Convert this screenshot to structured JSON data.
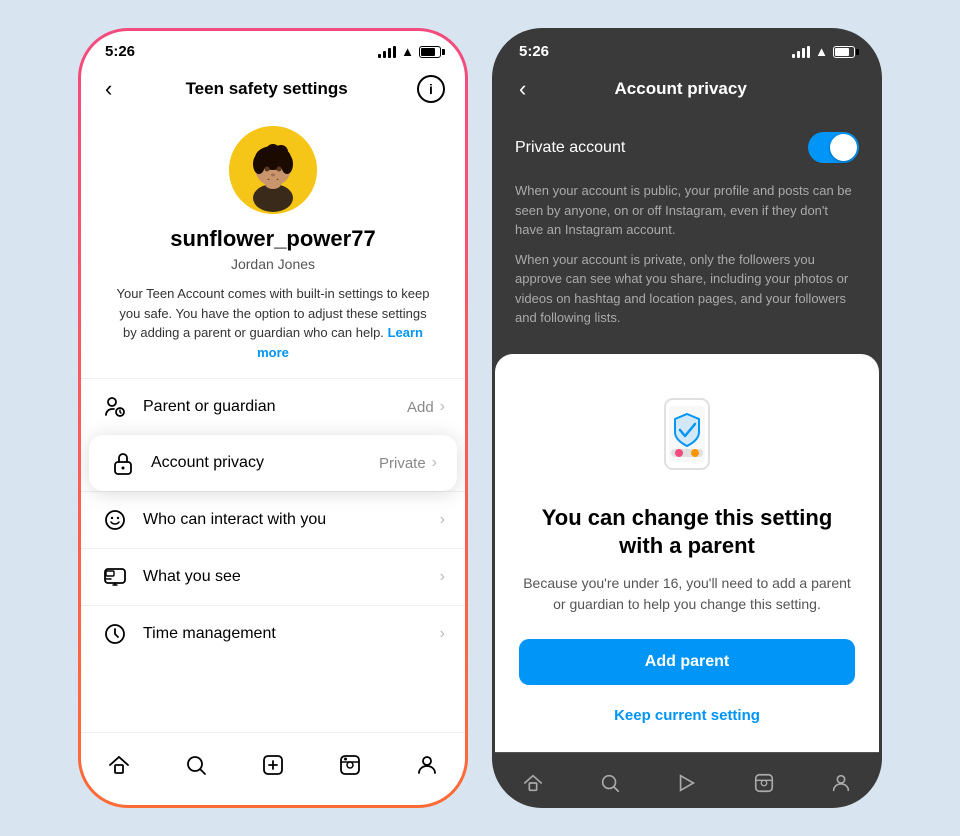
{
  "left_phone": {
    "status_bar": {
      "time": "5:26"
    },
    "header": {
      "title": "Teen safety settings",
      "back_label": "‹",
      "info_label": "i"
    },
    "profile": {
      "username": "sunflower_power77",
      "real_name": "Jordan Jones",
      "description": "Your Teen Account comes with built-in settings to keep you safe. You have the option to adjust these settings by adding a parent or guardian who can help.",
      "learn_more_label": "Learn more"
    },
    "settings": [
      {
        "icon": "👤",
        "icon_name": "guardian-icon",
        "label": "Parent or guardian",
        "value": "Add",
        "has_chevron": true
      },
      {
        "icon": "🔒",
        "icon_name": "lock-icon",
        "label": "Account privacy",
        "value": "Private",
        "has_chevron": true,
        "highlighted": true
      },
      {
        "icon": "💬",
        "icon_name": "interact-icon",
        "label": "Who can interact with you",
        "value": "",
        "has_chevron": true
      },
      {
        "icon": "📺",
        "icon_name": "see-icon",
        "label": "What you see",
        "value": "",
        "has_chevron": true
      },
      {
        "icon": "⏱",
        "icon_name": "time-icon",
        "label": "Time management",
        "value": "",
        "has_chevron": true
      }
    ],
    "bottom_nav": [
      {
        "icon": "🏠",
        "name": "home-nav"
      },
      {
        "icon": "🔍",
        "name": "search-nav"
      },
      {
        "icon": "➕",
        "name": "create-nav"
      },
      {
        "icon": "📺",
        "name": "reels-nav"
      },
      {
        "icon": "👤",
        "name": "profile-nav"
      }
    ]
  },
  "right_phone": {
    "status_bar": {
      "time": "5:26"
    },
    "header": {
      "title": "Account privacy",
      "back_label": "‹"
    },
    "toggle": {
      "label": "Private account",
      "enabled": true
    },
    "description": {
      "public_text": "When your account is public, your profile and posts can be seen by anyone, on or off Instagram, even if they don't have an Instagram account.",
      "private_text": "When your account is private, only the followers you approve can see what you share, including your photos or videos on hashtag and location pages, and your followers and following lists."
    },
    "modal": {
      "title": "You can change this setting with a parent",
      "description": "Because you're under 16, you'll need to add a parent or guardian to help you change this setting.",
      "add_parent_label": "Add parent",
      "keep_setting_label": "Keep current setting"
    },
    "bottom_nav": [
      {
        "icon": "🏠",
        "name": "home-nav-r"
      },
      {
        "icon": "🔍",
        "name": "search-nav-r"
      },
      {
        "icon": "📺",
        "name": "reels-nav-r"
      },
      {
        "icon": "📺",
        "name": "shop-nav-r"
      },
      {
        "icon": "👤",
        "name": "profile-nav-r"
      }
    ]
  }
}
